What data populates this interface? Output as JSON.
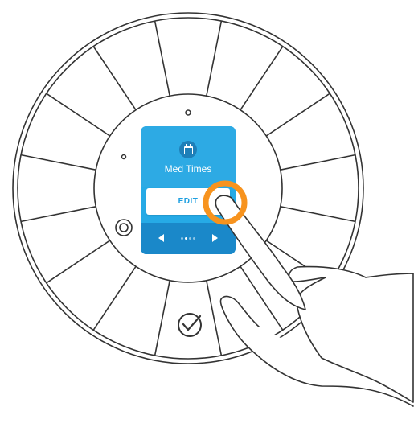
{
  "screen": {
    "icon": "calendar-icon",
    "title": "Med Times",
    "edit_label": "EDIT",
    "page_count": 4,
    "active_page_index": 1
  },
  "device": {
    "confirm_icon": "check-icon",
    "dial_segments": 16
  },
  "colors": {
    "screen_blue": "#26aae6",
    "nav_blue": "#1a88c9",
    "accent_orange": "#f7931e",
    "outline": "#333333"
  }
}
